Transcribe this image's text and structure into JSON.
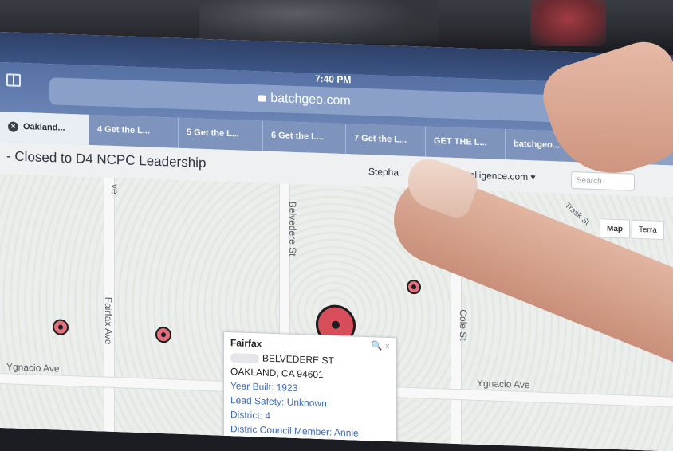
{
  "status_bar": {
    "time": "7:40 PM"
  },
  "address_bar": {
    "url": "batchgeo.com"
  },
  "tabs": [
    {
      "label": "Oakland...",
      "active": true
    },
    {
      "label": "4 Get the L...",
      "active": false
    },
    {
      "label": "5 Get the L...",
      "active": false
    },
    {
      "label": "6 Get the L...",
      "active": false
    },
    {
      "label": "7 Get the L...",
      "active": false
    },
    {
      "label": "GET THE L...",
      "active": false
    },
    {
      "label": "batchgeo...",
      "active": false
    }
  ],
  "page": {
    "title": "- Closed to D4 NCPC Leadership",
    "header_user": "Stepha",
    "header_account": "olitanintelligence.com ▾",
    "search_placeholder": "Search"
  },
  "map": {
    "streets": {
      "belvedere": "Belvedere St",
      "fairfax": "Fairfax Ave",
      "ygnacio_left": "Ygnacio Ave",
      "ygnacio_right": "Ygnacio Ave",
      "trask": "Trask St",
      "cole": "Cole St",
      "ve": "ve"
    },
    "map_button": "Map",
    "terrain_button": "Terra"
  },
  "popup": {
    "title": "Fairfax",
    "street": "BELVEDERE ST",
    "city_line": "OAKLAND, CA 94601",
    "year_built": "Year Built: 1923",
    "lead_safety": "Lead Safety: Unknown",
    "district": "District: 4",
    "council_member": "Distric Council Member: Annie",
    "close_glyphs": "🔍 ×"
  },
  "colors": {
    "marker_fill": "#e46f7c",
    "link_blue": "#3f6cc4",
    "safari_blue": "#6a83b5"
  }
}
